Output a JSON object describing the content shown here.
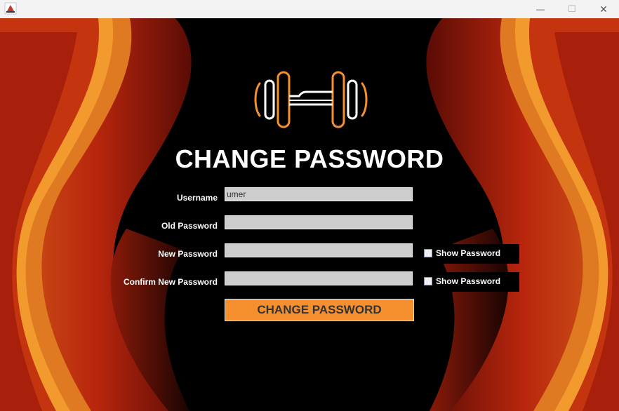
{
  "window": {
    "minimize_glyph": "—",
    "maximize_glyph": "☐",
    "close_glyph": "✕"
  },
  "header": {
    "title": "CHANGE PASSWORD"
  },
  "form": {
    "username_label": "Username",
    "username_value": "umer",
    "old_password_label": "Old Password",
    "new_password_label": "New Password",
    "confirm_password_label": "Confirm New Password",
    "show_password_label_1": "Show Password",
    "show_password_label_2": "Show Password",
    "submit_label": "CHANGE PASSWORD"
  },
  "colors": {
    "accent": "#f6902f",
    "field_bg": "#cdcdcd",
    "background": "#000000"
  }
}
